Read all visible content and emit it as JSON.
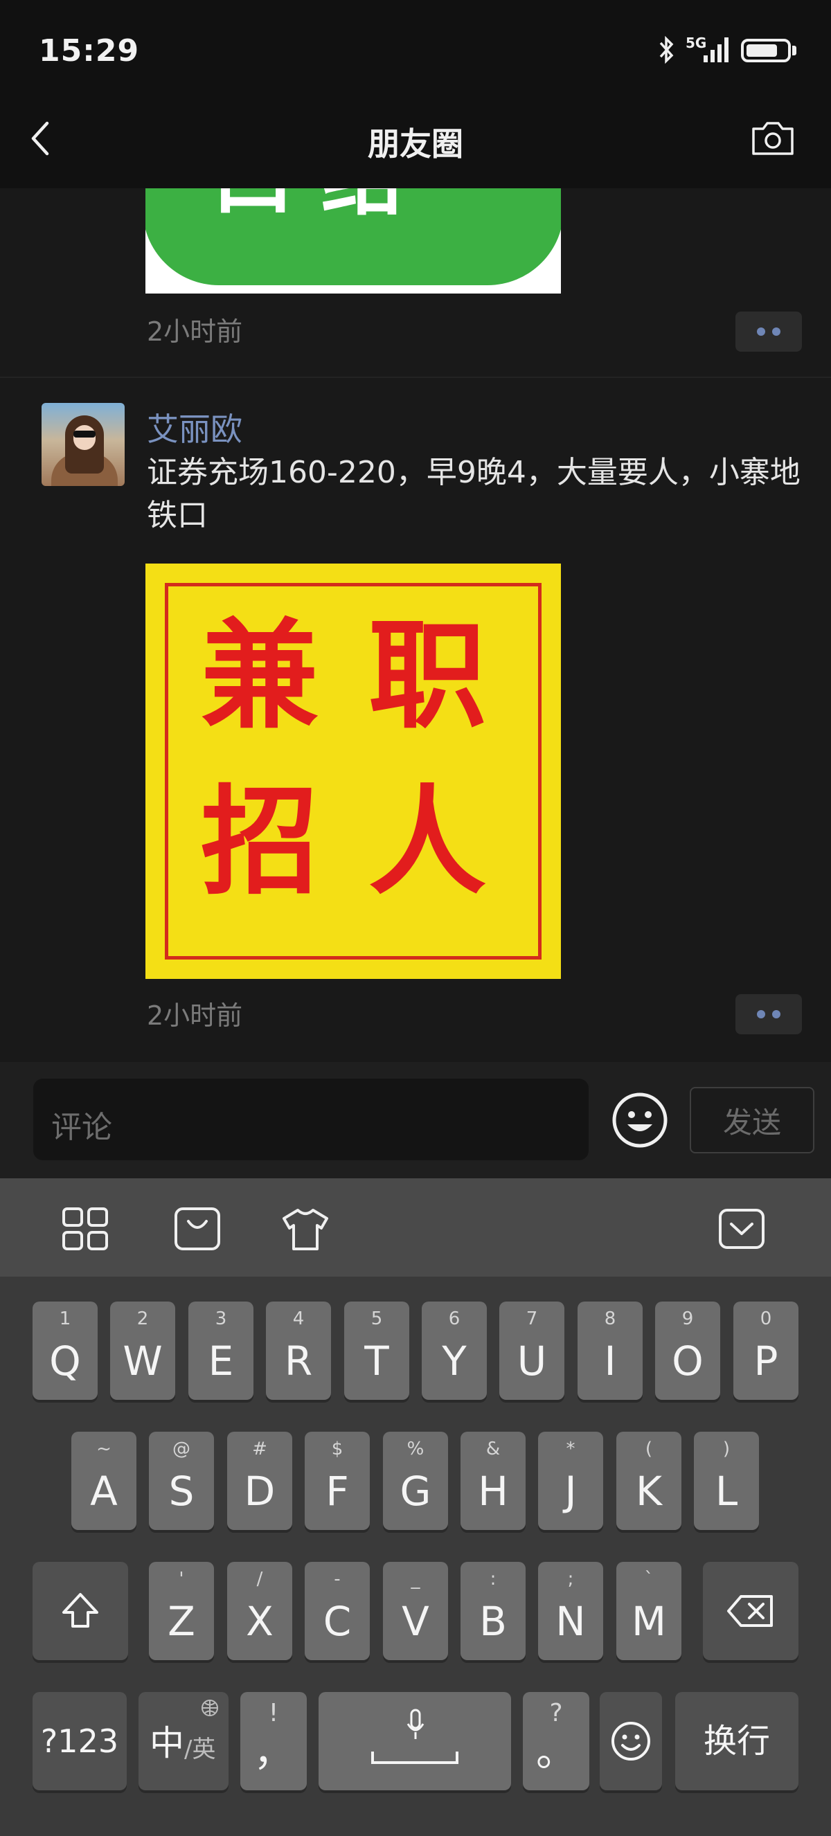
{
  "status_bar": {
    "time": "15:29",
    "network": "5G"
  },
  "header": {
    "title": "朋友圈"
  },
  "feed": {
    "prev_post": {
      "image_text": "口结",
      "time": "2小时前"
    },
    "post": {
      "author": "艾丽欧",
      "text": "证券充场160-220，早9晚4，大量要人，小寨地铁口",
      "image_text": [
        "兼",
        "职",
        "招",
        "人"
      ],
      "time": "2小时前"
    }
  },
  "comment_bar": {
    "placeholder": "评论",
    "send_label": "发送"
  },
  "keyboard": {
    "row1": [
      {
        "main": "Q",
        "sub": "1"
      },
      {
        "main": "W",
        "sub": "2"
      },
      {
        "main": "E",
        "sub": "3"
      },
      {
        "main": "R",
        "sub": "4"
      },
      {
        "main": "T",
        "sub": "5"
      },
      {
        "main": "Y",
        "sub": "6"
      },
      {
        "main": "U",
        "sub": "7"
      },
      {
        "main": "I",
        "sub": "8"
      },
      {
        "main": "O",
        "sub": "9"
      },
      {
        "main": "P",
        "sub": "0"
      }
    ],
    "row2": [
      {
        "main": "A",
        "sub": "~"
      },
      {
        "main": "S",
        "sub": "@"
      },
      {
        "main": "D",
        "sub": "#"
      },
      {
        "main": "F",
        "sub": "$"
      },
      {
        "main": "G",
        "sub": "%"
      },
      {
        "main": "H",
        "sub": "&"
      },
      {
        "main": "J",
        "sub": "*"
      },
      {
        "main": "K",
        "sub": "("
      },
      {
        "main": "L",
        "sub": ")"
      }
    ],
    "row3": [
      {
        "main": "Z",
        "sub": "'"
      },
      {
        "main": "X",
        "sub": "/"
      },
      {
        "main": "C",
        "sub": "-"
      },
      {
        "main": "V",
        "sub": "_"
      },
      {
        "main": "B",
        "sub": ":"
      },
      {
        "main": "N",
        "sub": ";"
      },
      {
        "main": "M",
        "sub": "`"
      }
    ],
    "num_key": "?123",
    "lang_key": "中",
    "lang_key_sub": "/英",
    "comma_key": "，",
    "comma_sub": "!",
    "period_key": "。",
    "period_sub": "?",
    "enter_key": "换行"
  }
}
